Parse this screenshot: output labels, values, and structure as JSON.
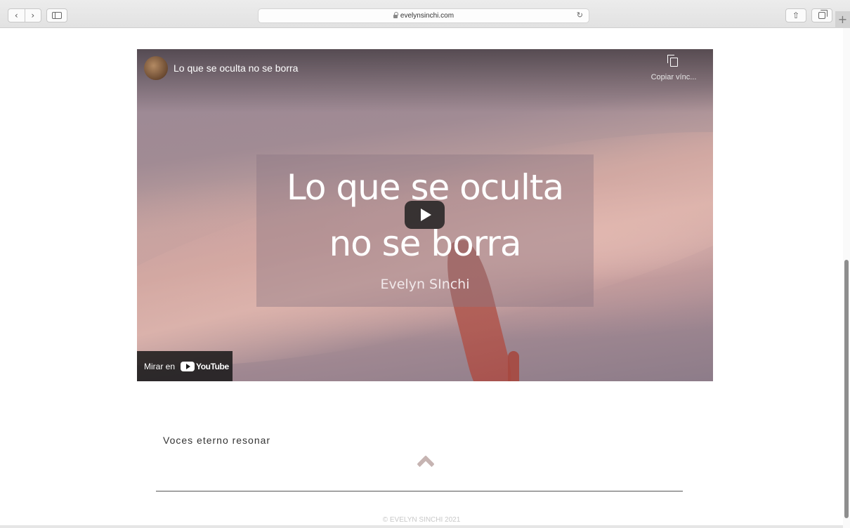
{
  "browser": {
    "url": "evelynsinchi.com",
    "back_glyph": "‹",
    "forward_glyph": "›",
    "reload_glyph": "↻",
    "share_glyph": "⇧",
    "new_tab_glyph": "+"
  },
  "video": {
    "title": "Lo que se oculta no se borra",
    "copy_link_label": "Copiar vínc...",
    "card_line1": "Lo que se oculta",
    "card_line2": "no se borra",
    "card_author": "Evelyn SInchi",
    "watch_on_label": "Mirar en",
    "youtube_label": "YouTube"
  },
  "page": {
    "section_text": "Voces eterno resonar",
    "footer": "© EVELYN SINCHI 2021"
  },
  "colors": {
    "accent_chevron": "#c6b4b2",
    "chrome_bg": "#e6e6e6"
  }
}
